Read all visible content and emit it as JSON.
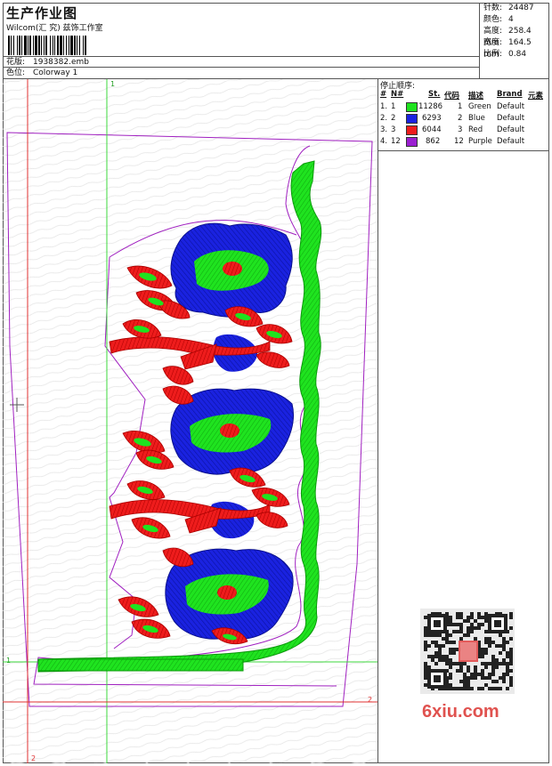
{
  "header": {
    "title": "生产作业图",
    "company": "Wilcom(汇 究) 兹饰工作室",
    "file_label": "花版:",
    "file_name": "1938382.emb",
    "colorway_label": "色位:",
    "colorway": "Colorway 1"
  },
  "stats": [
    {
      "label": "针数:",
      "value": "24487"
    },
    {
      "label": "颜色:",
      "value": "4"
    },
    {
      "label": "高度:",
      "value": "258.4 mm"
    },
    {
      "label": "宽度:",
      "value": "164.5 mm"
    },
    {
      "label": "比例:",
      "value": "0.84"
    }
  ],
  "stop_sequence": {
    "title": "停止顺序:",
    "columns": [
      "#",
      "N#",
      "St.",
      "代码",
      "描述",
      "Brand",
      "元素"
    ],
    "rows": [
      {
        "idx": "1.",
        "n": "1",
        "st": "11286",
        "code": "1",
        "desc": "Green",
        "brand": "Default",
        "color": "#1fe31f"
      },
      {
        "idx": "2.",
        "n": "2",
        "st": "6293",
        "code": "2",
        "desc": "Blue",
        "brand": "Default",
        "color": "#1a22e0"
      },
      {
        "idx": "3.",
        "n": "3",
        "st": "6044",
        "code": "3",
        "desc": "Red",
        "brand": "Default",
        "color": "#ee1c1c"
      },
      {
        "idx": "4.",
        "n": "12",
        "st": "862",
        "code": "12",
        "desc": "Purple",
        "brand": "Default",
        "color": "#9a1fd0"
      }
    ]
  },
  "canvas": {
    "axis_labels": {
      "top": "1",
      "left": "1",
      "right": "2",
      "bottom": "2"
    },
    "colors": {
      "green": "#1fe31f",
      "blue": "#1a22e0",
      "red": "#ee1c1c",
      "purple": "#a020c0",
      "guide_green": "#3cd83c",
      "guide_red": "#e03030"
    }
  },
  "watermark": {
    "text": "6xiu.com"
  }
}
